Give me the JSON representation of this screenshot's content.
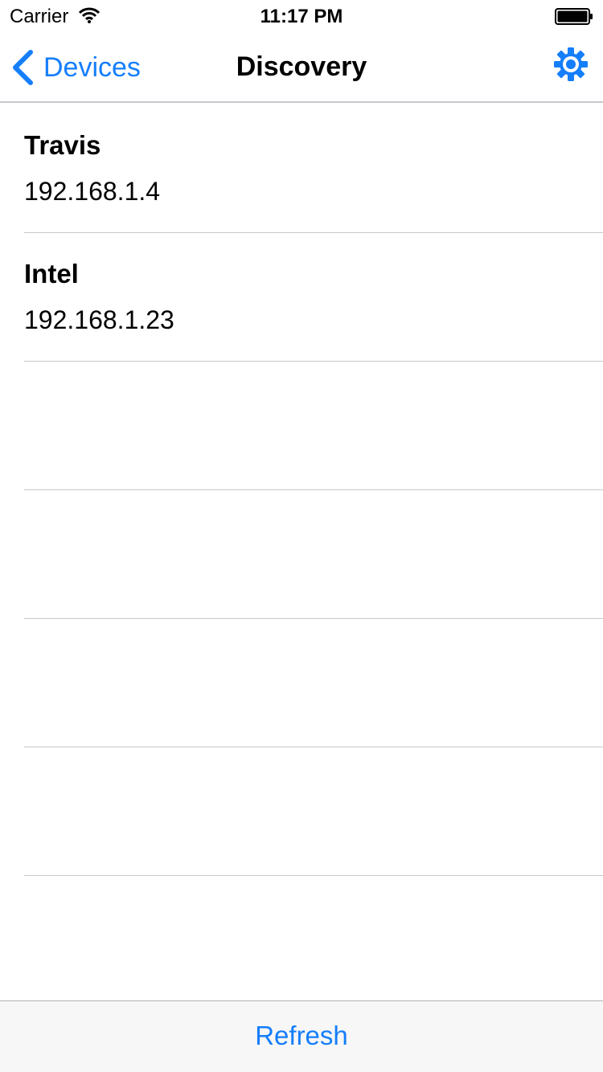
{
  "status_bar": {
    "carrier": "Carrier",
    "time": "11:17 PM"
  },
  "nav": {
    "back_label": "Devices",
    "title": "Discovery"
  },
  "devices": [
    {
      "name": "Travis",
      "ip": "192.168.1.4"
    },
    {
      "name": "Intel",
      "ip": "192.168.1.23"
    },
    {
      "name": "",
      "ip": ""
    },
    {
      "name": "",
      "ip": ""
    },
    {
      "name": "",
      "ip": ""
    },
    {
      "name": "",
      "ip": ""
    },
    {
      "name": "",
      "ip": ""
    }
  ],
  "toolbar": {
    "refresh_label": "Refresh"
  },
  "colors": {
    "accent": "#157efb",
    "separator": "#c8c7cc",
    "toolbar_bg": "#f7f7f7"
  },
  "icons": {
    "back": "chevron-left-icon",
    "settings": "gear-icon",
    "wifi": "wifi-icon",
    "battery": "battery-icon"
  }
}
